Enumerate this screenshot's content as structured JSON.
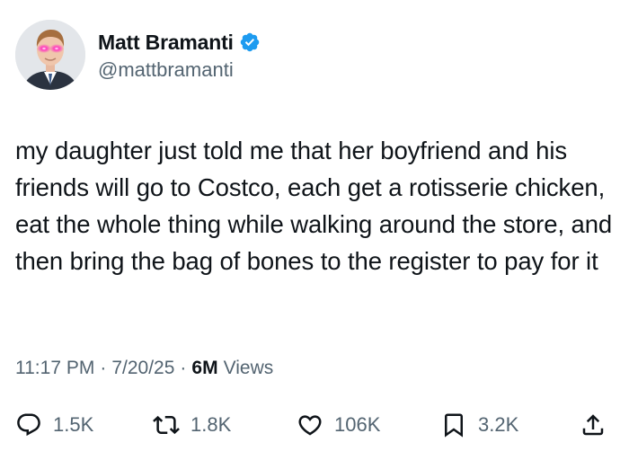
{
  "author": {
    "display_name": "Matt Bramanti",
    "handle": "@mattbramanti",
    "verified": true,
    "verified_color": "#1d9bf0"
  },
  "tweet": {
    "text": "my daughter just told me that her boyfriend and his friends will go to Costco, each get a rotisserie chicken, eat the whole thing while walking around the store, and then bring the bag of bones to the register to pay for it"
  },
  "meta": {
    "time": "11:17 PM",
    "separator": "·",
    "date": "7/20/25",
    "views_count": "6M",
    "views_label": "Views"
  },
  "actions": {
    "reply": {
      "icon": "reply-icon",
      "count": "1.5K"
    },
    "repost": {
      "icon": "repost-icon",
      "count": "1.8K"
    },
    "like": {
      "icon": "heart-icon",
      "count": "106K"
    },
    "bookmark": {
      "icon": "bookmark-icon",
      "count": "3.2K"
    },
    "share": {
      "icon": "share-icon"
    }
  }
}
